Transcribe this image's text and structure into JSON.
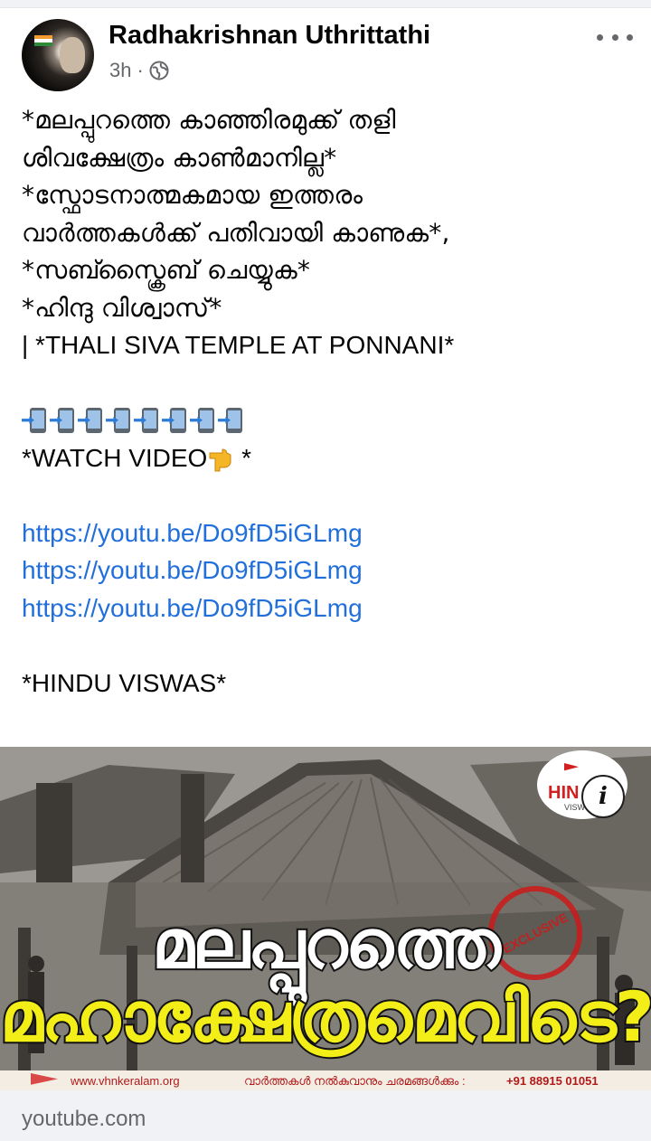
{
  "post": {
    "author": "Radhakrishnan Uthrittathi",
    "time": "3h",
    "separator": "·",
    "audience_icon": "globe-icon",
    "menu_icon": "more-options-icon",
    "text_lines": [
      "*മലപ്പുറത്തെ കാഞ്ഞിരമുക്ക് തളി",
      "ശിവക്ഷേത്രം കാൺമാനില്ല*",
      "*സ്ഫോടനാത്മകമായ ഇത്തരം",
      "വാർത്തകൾക്ക് പതിവായി കാണുക*,",
      "*സബ്സ്ക്രൈബ് ചെയ്യുക*",
      "*ഹിന്ദു വിശ്വാസ്*",
      " | *THALI SIVA TEMPLE AT PONNANI*"
    ],
    "emoji_row": [
      "phone-arrow-icon",
      "phone-arrow-icon",
      "phone-arrow-icon",
      "phone-arrow-icon",
      "phone-arrow-icon",
      "phone-arrow-icon",
      "phone-arrow-icon",
      "phone-arrow-icon"
    ],
    "watch_prefix": "*WATCH VIDEO",
    "watch_emoji": "pointing-down-icon",
    "watch_suffix": " *",
    "links": [
      "https://youtu.be/Do9fD5iGLmg",
      "https://youtu.be/Do9fD5iGLmg",
      "https://youtu.be/Do9fD5iGLmg"
    ],
    "closing": "*HINDU VISWAS*"
  },
  "preview": {
    "headline_1": "മലപ്പുറത്തെ",
    "headline_2": "മഹാക്ഷേത്രമെവിടെ?",
    "stamp": "EXCLUSIVE",
    "logo_text": "HIN",
    "logo_sub": "VISW",
    "info_icon": "info-icon",
    "footer_site": "www.vhnkeralam.org",
    "footer_note": "വാർത്തകൾ നൽകുവാനും ചരമങ്ങൾക്കും :",
    "footer_phone": "+91 88915 01051",
    "domain": "youtube.com"
  },
  "colors": {
    "link": "#216fdb",
    "meta": "#65676b",
    "headline_yellow": "#f3ee17",
    "bar_background": "#f0f2f5"
  }
}
